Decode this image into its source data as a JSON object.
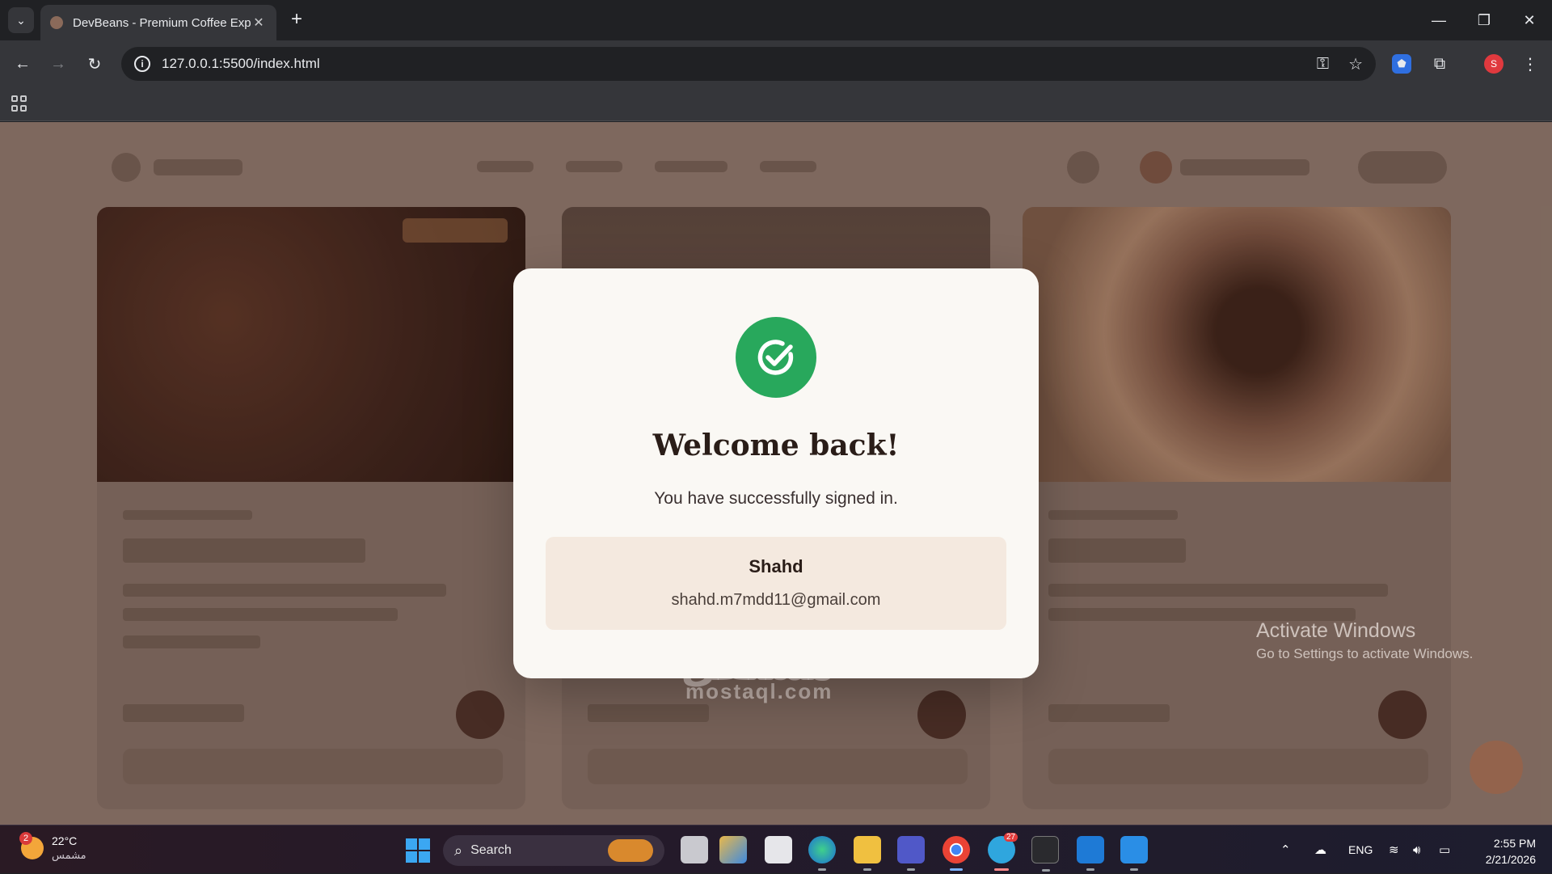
{
  "browser": {
    "tab_title": "DevBeans - Premium Coffee Experience",
    "url": "127.0.0.1:5500/index.html",
    "profile_initial": "S"
  },
  "modal": {
    "title": "Welcome back!",
    "subtitle": "You have successfully signed in.",
    "user_name": "Shahd",
    "user_email": "shahd.m7mdd11@gmail.com"
  },
  "watermarks": {
    "activate_title": "Activate Windows",
    "activate_sub": "Go to Settings to activate Windows.",
    "site_arabic": "مستقل",
    "site_latin": "mostaql.com"
  },
  "taskbar": {
    "weather_temp": "22°C",
    "weather_desc": "مشمس",
    "weather_badge": "2",
    "search_label": "Search",
    "telegram_badge": "27",
    "lang": "ENG",
    "time": "2:55 PM",
    "date": "2/21/2026"
  },
  "colors": {
    "success": "#28a85c",
    "modal_bg": "#faf8f4",
    "user_box_bg": "#f4e9df",
    "page_dim": "#8d776c"
  }
}
